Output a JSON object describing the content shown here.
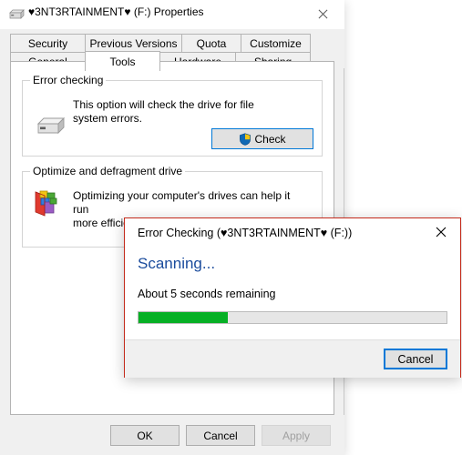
{
  "properties_window": {
    "title": "♥3NT3RTAINMENT♥ (F:) Properties",
    "icon": "hard-drive-icon",
    "close_label": "✕",
    "tabs_row_top": [
      {
        "label": "Security",
        "selected": false,
        "width": 83
      },
      {
        "label": "Previous Versions",
        "selected": false,
        "width": 107
      },
      {
        "label": "Quota",
        "selected": false,
        "width": 66
      },
      {
        "label": "Customize",
        "selected": false,
        "width": 77
      }
    ],
    "tabs_row_bottom": [
      {
        "label": "General",
        "selected": false,
        "width": 83
      },
      {
        "label": "Tools",
        "selected": true,
        "width": 83
      },
      {
        "label": "Hardware",
        "selected": false,
        "width": 84
      },
      {
        "label": "Sharing",
        "selected": false,
        "width": 83
      }
    ],
    "error_checking_group": {
      "title": "Error checking",
      "description": "This option will check the drive for file\nsystem errors.",
      "icon": "hard-drive-icon",
      "check_button": {
        "label": "Check",
        "icon": "uac-shield-icon"
      }
    },
    "optimize_group": {
      "title": "Optimize and defragment drive",
      "description": "Optimizing your computer's drives can help it run\nmore efficiently.",
      "icon": "defragment-icon"
    },
    "footer_buttons": {
      "ok": "OK",
      "cancel": "Cancel",
      "apply": "Apply",
      "apply_disabled": true
    }
  },
  "error_checking_dialog": {
    "title": "Error Checking (♥3NT3RTAINMENT♥ (F:))",
    "close_label": "✕",
    "status": "Scanning...",
    "time_remaining": "About 5 seconds remaining",
    "progress_percent": 29,
    "cancel_label": "Cancel",
    "colors": {
      "border": "#c42b1c",
      "status_text": "#1a4b9c",
      "progress_fill": "#06b025",
      "focus_border": "#0078d7"
    }
  }
}
